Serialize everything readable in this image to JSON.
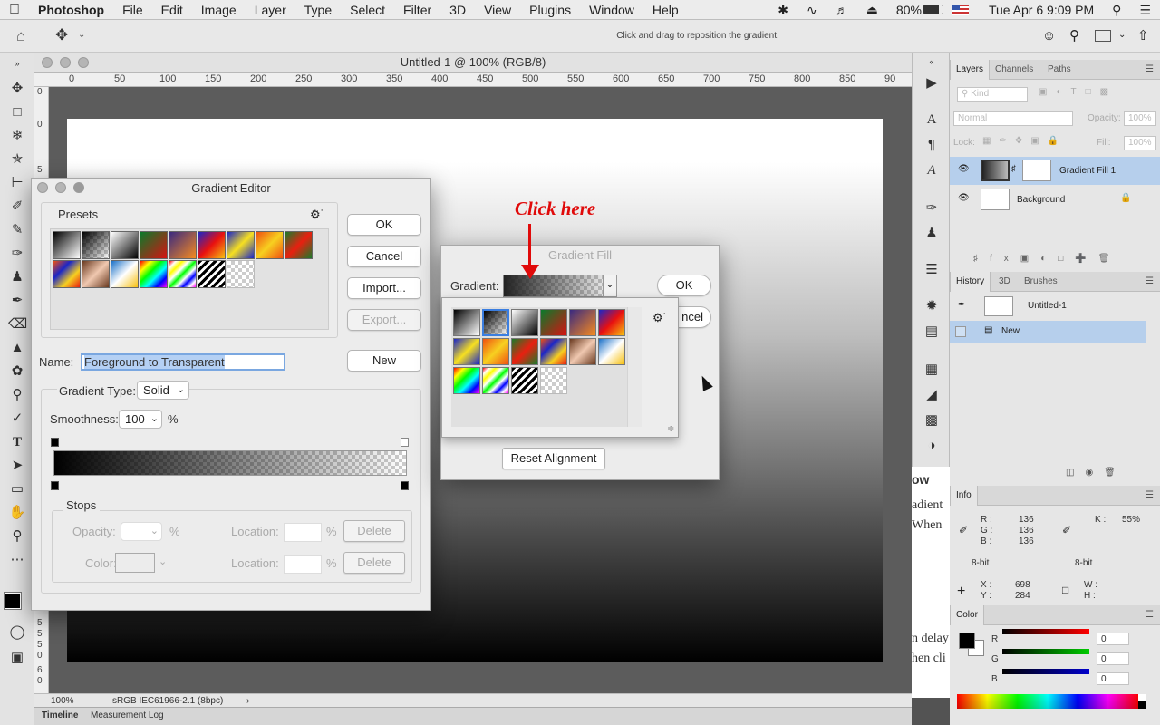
{
  "menubar": {
    "app": "Photoshop",
    "items": [
      "File",
      "Edit",
      "Image",
      "Layer",
      "Type",
      "Select",
      "Filter",
      "3D",
      "View",
      "Plugins",
      "Window",
      "Help"
    ],
    "battery": "80%",
    "datetime": "Tue Apr 6  9:09 PM"
  },
  "options": {
    "hint": "Click and drag to reposition the gradient."
  },
  "document": {
    "title": "Untitled-1 @ 100% (RGB/8)",
    "ruler_labels": [
      "0",
      "50",
      "100",
      "150",
      "200",
      "250",
      "300",
      "350",
      "400",
      "450",
      "500",
      "550",
      "600",
      "650",
      "700",
      "750",
      "800",
      "850",
      "90"
    ],
    "vruler_labels": [
      "0",
      "0",
      "5",
      "5",
      "5",
      "5",
      "0",
      "6",
      "0"
    ],
    "zoom": "100%",
    "profile": "sRGB IEC61966-2.1 (8bpc)"
  },
  "bottom_tabs": {
    "timeline": "Timeline",
    "measurement": "Measurement Log"
  },
  "gradient_editor": {
    "title": "Gradient Editor",
    "presets_label": "Presets",
    "ok": "OK",
    "cancel": "Cancel",
    "import": "Import...",
    "export": "Export...",
    "name_label": "Name:",
    "name_value": "Foreground to Transparent",
    "new": "New",
    "type_label": "Gradient Type:",
    "type_value": "Solid",
    "smooth_label": "Smoothness:",
    "smooth_value": "100",
    "percent": "%",
    "stops_label": "Stops",
    "opacity_label": "Opacity:",
    "color_label": "Color:",
    "location_label": "Location:",
    "delete": "Delete"
  },
  "gradient_fill": {
    "title": "Gradient Fill",
    "gradient_label": "Gradient:",
    "ok": "OK",
    "cancel_partial": "ncel",
    "reset": "Reset Alignment"
  },
  "callout": {
    "text": "Click here"
  },
  "layers_panel": {
    "tabs": [
      "Layers",
      "Channels",
      "Paths"
    ],
    "kind": "Kind",
    "blend": "Normal",
    "opacity_label": "Opacity:",
    "opacity_value": "100%",
    "lock_label": "Lock:",
    "fill_label": "Fill:",
    "fill_value": "100%",
    "layers": [
      {
        "name": "Gradient Fill 1",
        "selected": true
      },
      {
        "name": "Background",
        "selected": false
      }
    ]
  },
  "history_panel": {
    "tabs": [
      "History",
      "3D",
      "Brushes"
    ],
    "snapshot": "Untitled-1",
    "items": [
      "New"
    ]
  },
  "info_panel": {
    "title": "Info",
    "r_label": "R :",
    "r": "136",
    "g_label": "G :",
    "g": "136",
    "b_label": "B :",
    "b": "136",
    "k_label": "K :",
    "k": "55%",
    "bitl": "8-bit",
    "bitr": "8-bit",
    "x_label": "X :",
    "x": "698",
    "y_label": "Y :",
    "y": "284",
    "w_label": "W :",
    "h_label": "H :"
  },
  "color_panel": {
    "title": "Color",
    "r_label": "R",
    "r": "0",
    "g_label": "G",
    "g": "0",
    "b_label": "B",
    "b": "0"
  },
  "bg_text": {
    "a": "ow",
    "b": "adient",
    "c": "When",
    "d": "n delay",
    "e": "hen cli"
  }
}
